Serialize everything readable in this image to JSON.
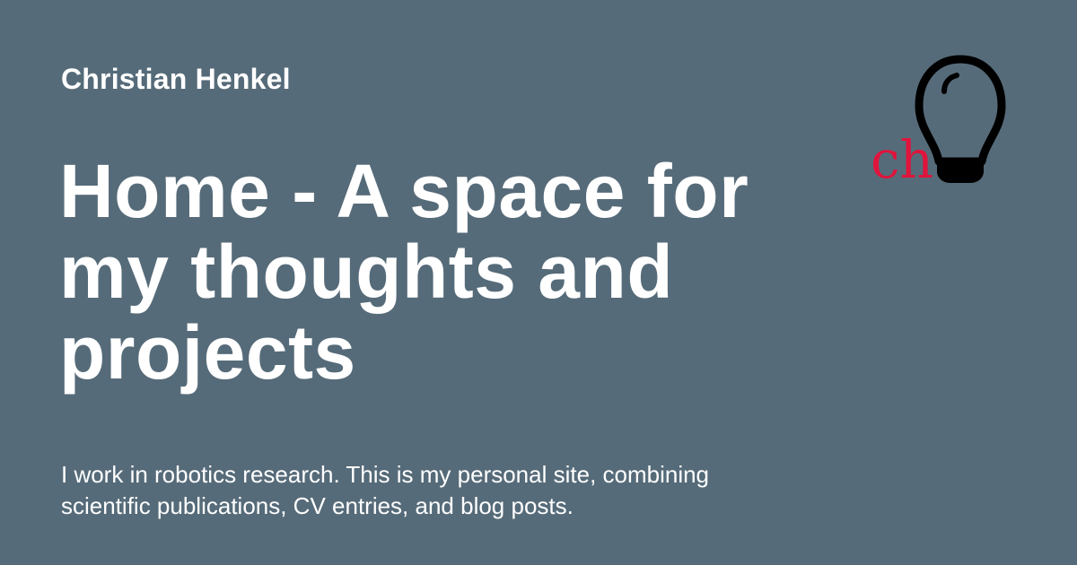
{
  "site": {
    "name": "Christian Henkel"
  },
  "page": {
    "title": "Home - A space for my thoughts and projects",
    "description": "I work in robotics research. This is my personal site, combining scientific publications, CV entries, and blog posts."
  },
  "logo": {
    "text": "ch",
    "icon": "lightbulb-icon",
    "text_color": "#e0143c",
    "icon_color": "#000000"
  },
  "colors": {
    "background": "#566b79",
    "text": "#ffffff"
  }
}
